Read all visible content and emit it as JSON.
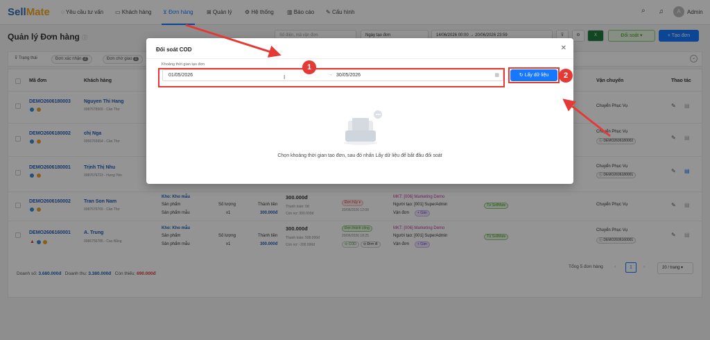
{
  "app": {
    "logo_left": "Sell",
    "logo_right": "Mate",
    "nav": [
      "Yêu cầu tư vấn",
      "Khách hàng",
      "Đơn hàng",
      "Quản lý",
      "Hệ thống",
      "Báo cáo",
      "Cấu hình"
    ],
    "user": "Admin"
  },
  "page": {
    "title": "Quản lý Đơn hàng",
    "search_placeholder": "Số điện, mã vận đơn",
    "date_type": "Ngày tạo đơn",
    "date_from": "14/06/2026 00:00",
    "date_to": "20/06/2026 23:59",
    "reconcile_btn": "Đối soát",
    "create_btn": "+ Tạo đơn"
  },
  "filters": {
    "status_label": "Trạng thái",
    "chips": [
      {
        "label": "Đơn xác nhận",
        "count": "2"
      },
      {
        "label": "Đơn chờ giao",
        "count": "1"
      }
    ]
  },
  "table": {
    "headers": [
      "Mã đơn",
      "Khách hàng",
      "Vận chuyển",
      "Thao tác"
    ],
    "rows": [
      {
        "code": "DEMO2606180003",
        "customer": "Nguyen Thi Hang",
        "phone": "0987678565 - Cần Thơ",
        "ship": "Chuyển Phục Vụ",
        "tracking": ""
      },
      {
        "code": "DEMO2606180002",
        "customer": "chị Nga",
        "phone": "0956765654 - Cần Thơ",
        "ship": "Chuyển Phục Vụ",
        "tracking": "DEMO2606180002"
      },
      {
        "code": "DEMO2606180001",
        "customer": "Trịnh Thị Nhu",
        "phone": "0987676723 - Hưng Yên",
        "ship": "Chuyển Phục Vụ",
        "tracking": "DEMO2606180001"
      },
      {
        "code": "DEMO2606160002",
        "customer": "Tran Son Nam",
        "phone": "0987676765 - Cần Thơ",
        "warehouse": "Kho: Kho mẫu",
        "product_label": "Sản phẩm",
        "product": "Sản phẩm mẫu",
        "qty_label": "Số lượng",
        "qty": "x1",
        "total_label": "Thành tiền",
        "total": "300.000đ",
        "amount": "300.000đ",
        "paid": "Thanh toán: 0đ",
        "remain": "Còn nợ: 300.000đ",
        "status": "Đơn hủy",
        "status_time": "20/06/2026 12:09",
        "mkt": "MKT: [006] Marketing Demo",
        "creator": "Người tạo: [001] SuperAdmin",
        "waybill": "Vận đơn",
        "add": "+ Gán",
        "source": "Từ SellMate",
        "ship": "Chuyển Phục Vụ",
        "tracking": ""
      },
      {
        "code": "DEMO2606160001",
        "customer": "A. Trung",
        "phone": "0986756785 - Cao Bằng",
        "warehouse": "Kho: Kho mẫu",
        "product_label": "Sản phẩm",
        "product": "Sản phẩm mẫu",
        "qty_label": "Số lượng",
        "qty": "x1",
        "total_label": "Thành tiền",
        "total": "300.000đ",
        "amount": "300.000đ",
        "paid": "Thanh toán: 500.000đ",
        "remain": "Còn nợ: -200.000đ",
        "status": "Đơn thành công",
        "status_time": "20/06/2026 18:25",
        "cod": "COD",
        "delivered": "Đơn đi",
        "mkt": "MKT: [006] Marketing Demo",
        "creator": "Người tạo: [001] SuperAdmin",
        "waybill": "Vận đơn",
        "add": "+ Gán",
        "source": "Từ SellMate",
        "ship": "Chuyển Phục Vụ",
        "tracking": "DEMO2606160001"
      }
    ]
  },
  "footer": {
    "sales_label": "Doanh số:",
    "sales": "3.680.000đ",
    "revenue_label": "Doanh thu:",
    "revenue": "3.380.000đ",
    "owed_label": "Còn thiếu:",
    "owed": "690.000đ",
    "total_orders": "Tổng 5 đơn hàng",
    "page": "1",
    "page_size": "20 / trang"
  },
  "modal": {
    "title": "Đối soát COD",
    "range_label": "Khoảng thời gian tạo đơn",
    "from": "01/05/2026",
    "to": "30/05/2026",
    "fetch_btn": "Lấy dữ liệu",
    "empty_text": "Chọn khoảng thời gian tạo đơn, sau đó nhấn Lấy dữ liệu để bắt đầu đối soát"
  },
  "annotations": {
    "step1": "1",
    "step2": "2",
    "highlight_color": "#e53935"
  }
}
